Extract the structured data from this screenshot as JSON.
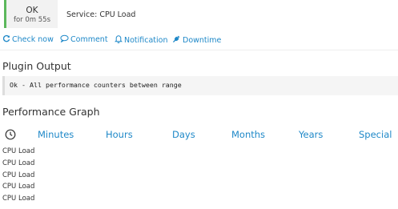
{
  "status": {
    "state": "OK",
    "duration": "for 0m 55s",
    "color": "#5cb85c"
  },
  "service": {
    "title": "Service: CPU Load"
  },
  "actions": [
    {
      "label": "Check now",
      "icon": "refresh-icon"
    },
    {
      "label": "Comment",
      "icon": "comment-icon"
    },
    {
      "label": "Notification",
      "icon": "bell-icon"
    },
    {
      "label": "Downtime",
      "icon": "plug-icon"
    }
  ],
  "plugin_output": {
    "heading": "Plugin Output",
    "text": "Ok - All performance counters between range"
  },
  "performance_graph": {
    "heading": "Performance Graph",
    "clock_icon": "clock-icon",
    "ranges": [
      "Minutes",
      "Hours",
      "Days",
      "Months",
      "Years",
      "Special"
    ],
    "graphs": [
      "CPU Load",
      "CPU Load",
      "CPU Load",
      "CPU Load",
      "CPU Load"
    ]
  },
  "colors": {
    "link": "#1e88c8",
    "ok": "#5cb85c"
  }
}
